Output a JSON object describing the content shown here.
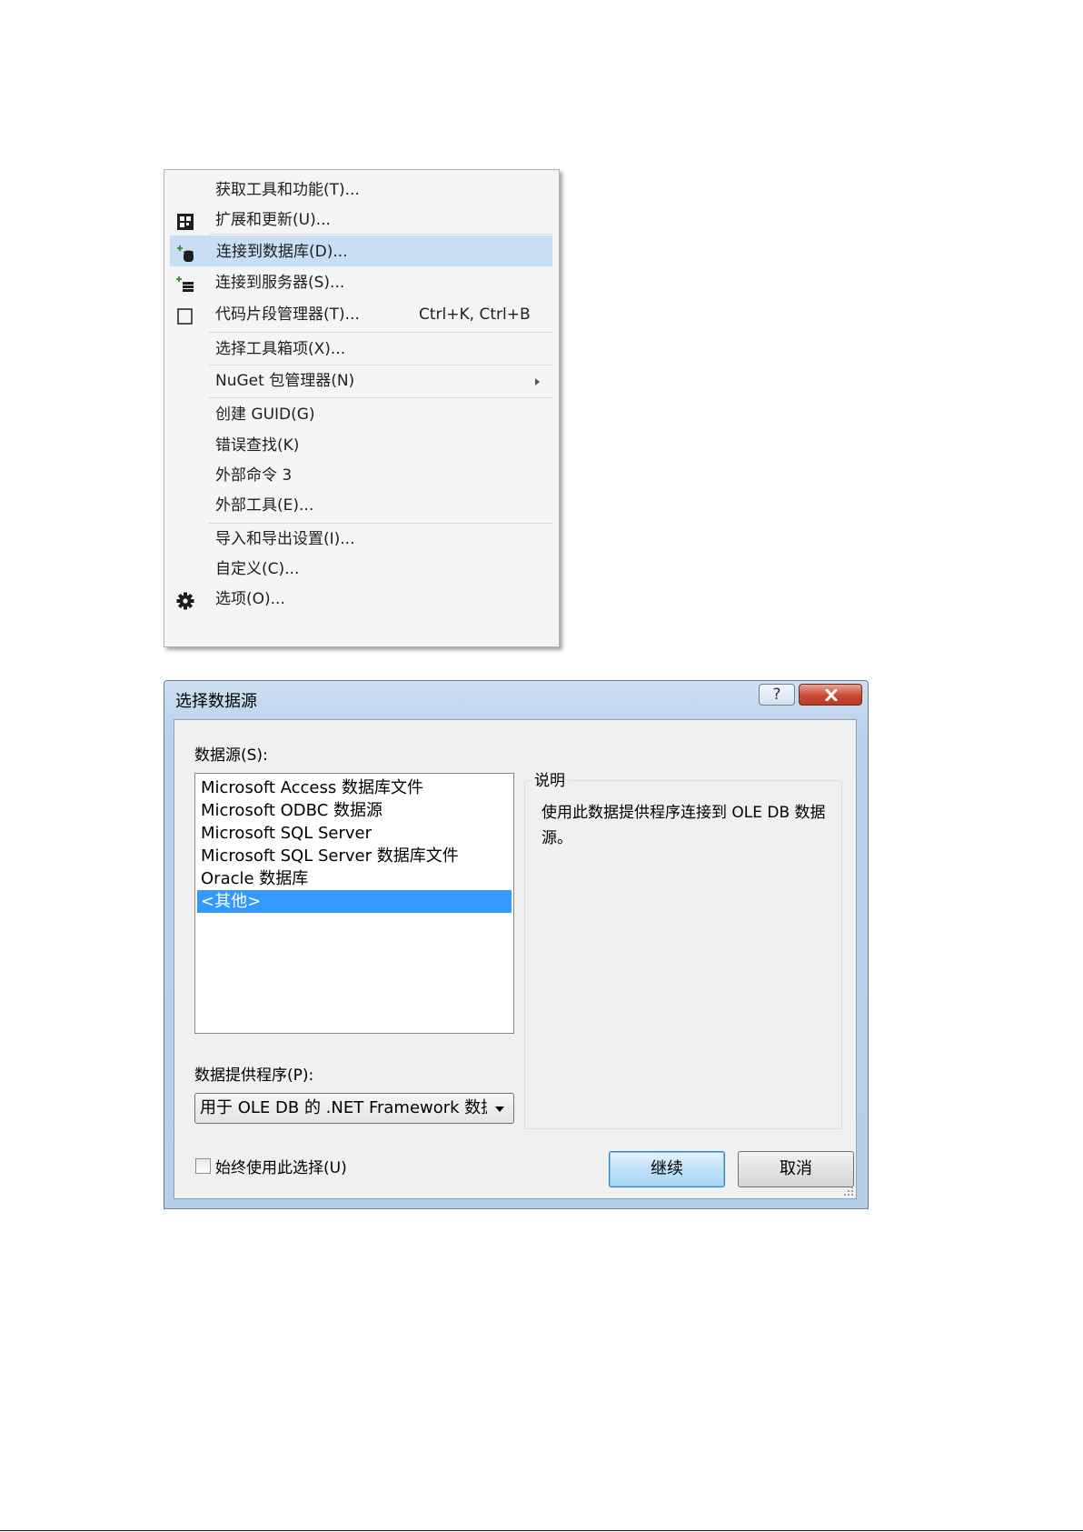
{
  "menu": {
    "items": [
      {
        "label": "获取工具和功能(T)...",
        "icon": null,
        "shortcut": null,
        "submenu": false,
        "highlighted": false
      },
      {
        "label": "扩展和更新(U)...",
        "icon": "extensions-icon",
        "shortcut": null,
        "submenu": false,
        "highlighted": false
      },
      {
        "label": "连接到数据库(D)...",
        "icon": "database-connect-icon",
        "shortcut": null,
        "submenu": false,
        "highlighted": true
      },
      {
        "label": "连接到服务器(S)...",
        "icon": "server-connect-icon",
        "shortcut": null,
        "submenu": false,
        "highlighted": false
      },
      {
        "label": "代码片段管理器(T)...",
        "icon": "snippet-icon",
        "shortcut": "Ctrl+K, Ctrl+B",
        "submenu": false,
        "highlighted": false
      },
      {
        "label": "选择工具箱项(X)...",
        "icon": null,
        "shortcut": null,
        "submenu": false,
        "highlighted": false
      },
      {
        "label": "NuGet 包管理器(N)",
        "icon": null,
        "shortcut": null,
        "submenu": true,
        "highlighted": false
      },
      {
        "label": "创建 GUID(G)",
        "icon": null,
        "shortcut": null,
        "submenu": false,
        "highlighted": false
      },
      {
        "label": "错误查找(K)",
        "icon": null,
        "shortcut": null,
        "submenu": false,
        "highlighted": false
      },
      {
        "label": "外部命令 3",
        "icon": null,
        "shortcut": null,
        "submenu": false,
        "highlighted": false
      },
      {
        "label": "外部工具(E)...",
        "icon": null,
        "shortcut": null,
        "submenu": false,
        "highlighted": false
      },
      {
        "label": "导入和导出设置(I)...",
        "icon": null,
        "shortcut": null,
        "submenu": false,
        "highlighted": false
      },
      {
        "label": "自定义(C)...",
        "icon": null,
        "shortcut": null,
        "submenu": false,
        "highlighted": false
      },
      {
        "label": "选项(O)...",
        "icon": "gear-icon",
        "shortcut": null,
        "submenu": false,
        "highlighted": false
      }
    ]
  },
  "dialog": {
    "title": "选择数据源",
    "help_label": "?",
    "close_icon": "close-icon",
    "datasource_label": "数据源(S):",
    "datasources": [
      {
        "label": "Microsoft Access 数据库文件",
        "selected": false
      },
      {
        "label": "Microsoft ODBC 数据源",
        "selected": false
      },
      {
        "label": "Microsoft SQL Server",
        "selected": false
      },
      {
        "label": "Microsoft SQL Server 数据库文件",
        "selected": false
      },
      {
        "label": "Oracle 数据库",
        "selected": false
      },
      {
        "label": "<其他>",
        "selected": true
      }
    ],
    "description_title": "说明",
    "description_text": "使用此数据提供程序连接到 OLE DB 数据源。",
    "provider_label": "数据提供程序(P):",
    "provider_value": "用于 OLE DB 的 .NET Framework 数据提供程序",
    "always_use_label": "始终使用此选择(U)",
    "always_use_checked": false,
    "continue_label": "继续",
    "cancel_label": "取消"
  },
  "colors": {
    "highlight": "#c9def5",
    "selection": "#3399ff",
    "dialog_frame": "#b9d1ea"
  }
}
